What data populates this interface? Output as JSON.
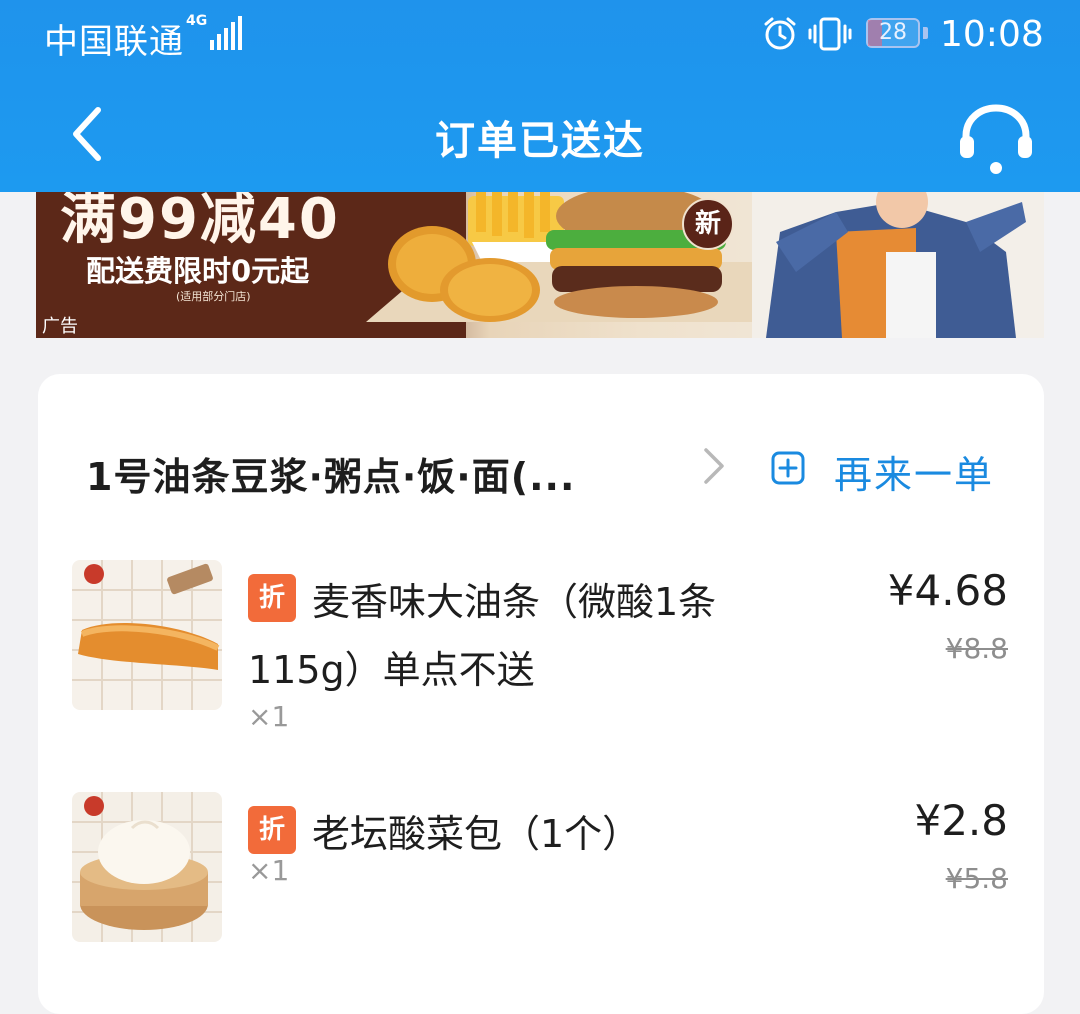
{
  "status_bar": {
    "carrier": "中国联通",
    "network": "4G",
    "battery": "28",
    "battery_level": 0.28,
    "time": "10:08"
  },
  "nav": {
    "title": "订单已送达",
    "back_icon": "chevron-left-icon",
    "support_icon": "headset-icon"
  },
  "ad": {
    "headline": "满99减40",
    "subline": "配送费限时0元起",
    "note": "(适用部分门店)",
    "new_badge": "新",
    "tag": "广告"
  },
  "order": {
    "store_name": "1号油条豆浆·粥点·饭·面(...",
    "reorder_label": "再来一单",
    "accent_color": "#1a8ae0",
    "items": [
      {
        "badge": "折",
        "name": "麦香味大油条（微酸1条115g）单点不送",
        "quantity": "×1",
        "price": "¥4.68",
        "original_price": "¥8.8"
      },
      {
        "badge": "折",
        "name": "老坛酸菜包（1个）",
        "quantity": "×1",
        "price": "¥2.8",
        "original_price": "¥5.8"
      }
    ]
  }
}
